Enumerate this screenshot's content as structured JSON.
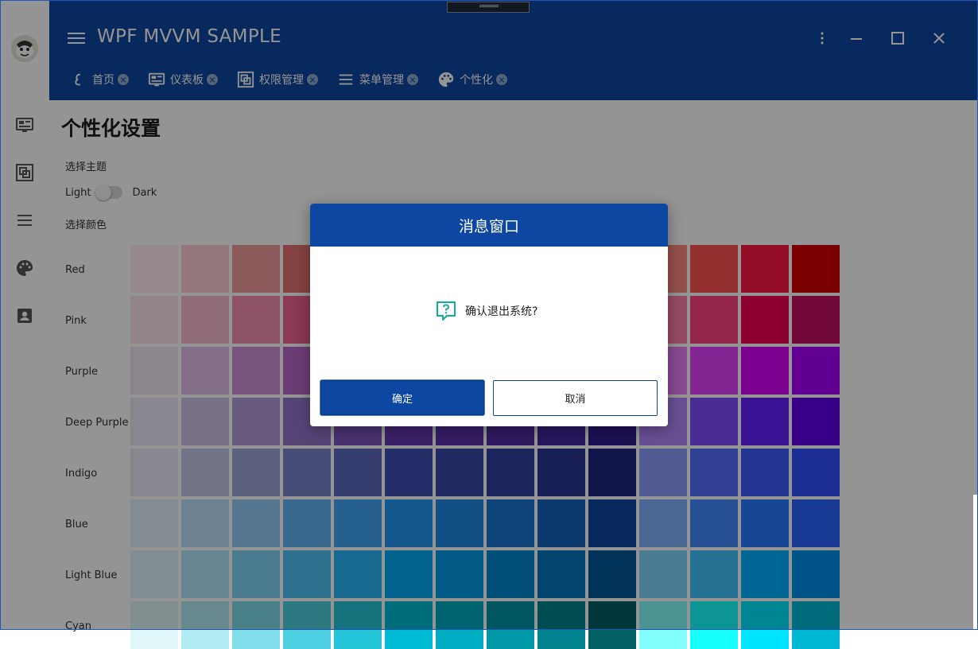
{
  "window": {
    "title": "WPF MVVM SAMPLE"
  },
  "tabs": [
    {
      "label": "首页",
      "icon": "home-icon"
    },
    {
      "label": "仪表板",
      "icon": "dashboard-icon"
    },
    {
      "label": "权限管理",
      "icon": "permission-icon"
    },
    {
      "label": "菜单管理",
      "icon": "menu-list-icon"
    },
    {
      "label": "个性化",
      "icon": "palette-icon"
    }
  ],
  "sidebar": {
    "items": [
      {
        "icon": "dashboard-icon"
      },
      {
        "icon": "permission-icon"
      },
      {
        "icon": "menu-list-icon"
      },
      {
        "icon": "palette-icon"
      },
      {
        "icon": "account-box-icon"
      }
    ]
  },
  "page": {
    "title": "个性化设置",
    "theme_label": "选择主题",
    "light_label": "Light",
    "dark_label": "Dark",
    "theme_dark_enabled": false,
    "color_label": "选择颜色",
    "color_rows": [
      {
        "name": "Red",
        "swatches": [
          "#ffebee",
          "#ffcdd2",
          "#ef9a9a",
          "#e57373",
          "#ef5350",
          "#f44336",
          "#e53935",
          "#d32f2f",
          "#c62828",
          "#b71c1c",
          "#ff8a80",
          "#ff5252",
          "#ff1744",
          "#d50000"
        ]
      },
      {
        "name": "Pink",
        "swatches": [
          "#fce4ec",
          "#f8bbd0",
          "#f48fb1",
          "#f06292",
          "#ec407a",
          "#e91e63",
          "#d81b60",
          "#c2185b",
          "#ad1457",
          "#880e4f",
          "#ff80ab",
          "#ff4081",
          "#f50057",
          "#c51162"
        ]
      },
      {
        "name": "Purple",
        "swatches": [
          "#f3e5f5",
          "#e1bee7",
          "#ce93d8",
          "#ba68c8",
          "#ab47bc",
          "#9c27b0",
          "#8e24aa",
          "#7b1fa2",
          "#6a1b9a",
          "#4a148c",
          "#ea80fc",
          "#e040fb",
          "#d500f9",
          "#aa00ff"
        ]
      },
      {
        "name": "Deep Purple",
        "swatches": [
          "#ede7f6",
          "#d1c4e9",
          "#b39ddb",
          "#9575cd",
          "#7e57c2",
          "#673ab7",
          "#5e35b1",
          "#512da8",
          "#4527a0",
          "#311b92",
          "#b388ff",
          "#7c4dff",
          "#651fff",
          "#6200ea"
        ]
      },
      {
        "name": "Indigo",
        "swatches": [
          "#e8eaf6",
          "#c5cae9",
          "#9fa8da",
          "#7986cb",
          "#5c6bc0",
          "#3f51b5",
          "#3949ab",
          "#303f9f",
          "#283593",
          "#1a237e",
          "#8c9eff",
          "#536dfe",
          "#3d5afe",
          "#304ffe"
        ]
      },
      {
        "name": "Blue",
        "swatches": [
          "#e3f2fd",
          "#bbdefb",
          "#90caf9",
          "#64b5f6",
          "#42a5f5",
          "#2196f3",
          "#1e88e5",
          "#1976d2",
          "#1565c0",
          "#0d47a1",
          "#82b1ff",
          "#448aff",
          "#2979ff",
          "#2962ff"
        ]
      },
      {
        "name": "Light Blue",
        "swatches": [
          "#e1f5fe",
          "#b3e5fc",
          "#81d4fa",
          "#4fc3f7",
          "#29b6f6",
          "#03a9f4",
          "#039be5",
          "#0288d1",
          "#0277bd",
          "#01579b",
          "#80d8ff",
          "#40c4ff",
          "#00b0ff",
          "#0091ea"
        ]
      },
      {
        "name": "Cyan",
        "swatches": [
          "#e0f7fa",
          "#b2ebf2",
          "#80deea",
          "#4dd0e1",
          "#26c6da",
          "#00bcd4",
          "#00acc1",
          "#0097a7",
          "#00838f",
          "#006064",
          "#84ffff",
          "#18ffff",
          "#00e5ff",
          "#00b8d4"
        ]
      }
    ]
  },
  "dialog": {
    "title": "消息窗口",
    "message": "确认退出系统?",
    "message_icon": "help-question-icon",
    "ok_label": "确定",
    "cancel_label": "取消"
  },
  "colors": {
    "primary": "#0d47a1",
    "message_icon": "#26a69a"
  }
}
